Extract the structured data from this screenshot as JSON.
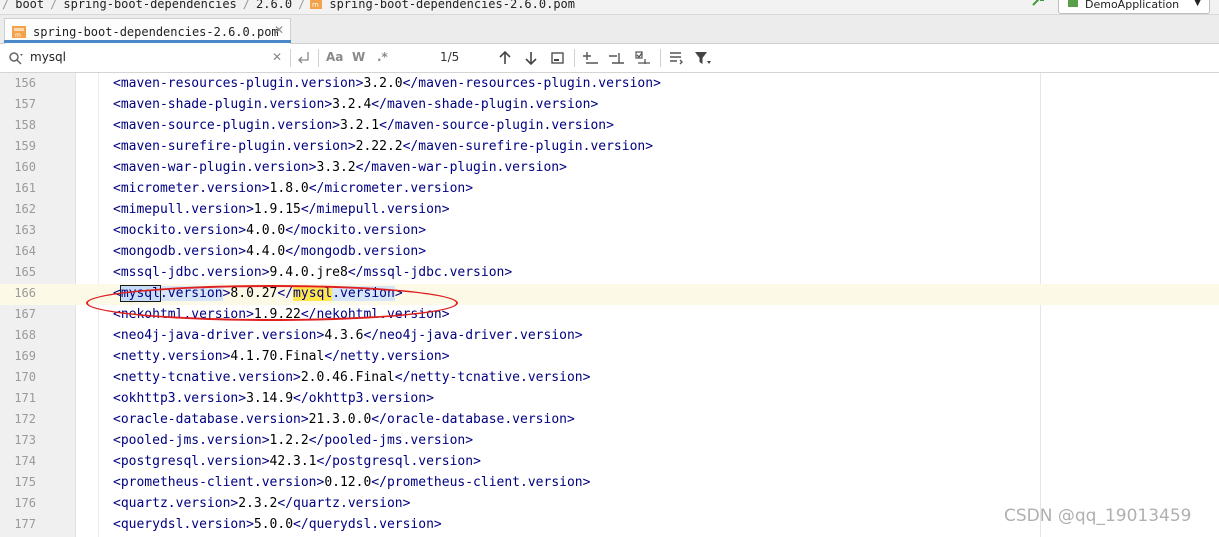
{
  "breadcrumb": [
    "boot",
    "spring-boot-dependencies",
    "2.6.0",
    "spring-boot-dependencies-2.6.0.pom"
  ],
  "run_config": "DemoApplication",
  "tab": {
    "label": "spring-boot-dependencies-2.6.0.pom"
  },
  "find": {
    "query": "mysql",
    "match_case": "Aa",
    "words": "W",
    "regex": ".*",
    "counter": "1/5"
  },
  "editor": {
    "lines": [
      {
        "n": "156",
        "tag": "maven-resources-plugin.version",
        "val": "3.2.0"
      },
      {
        "n": "157",
        "tag": "maven-shade-plugin.version",
        "val": "3.2.4"
      },
      {
        "n": "158",
        "tag": "maven-source-plugin.version",
        "val": "3.2.1"
      },
      {
        "n": "159",
        "tag": "maven-surefire-plugin.version",
        "val": "2.22.2"
      },
      {
        "n": "160",
        "tag": "maven-war-plugin.version",
        "val": "3.3.2"
      },
      {
        "n": "161",
        "tag": "micrometer.version",
        "val": "1.8.0"
      },
      {
        "n": "162",
        "tag": "mimepull.version",
        "val": "1.9.15"
      },
      {
        "n": "163",
        "tag": "mockito.version",
        "val": "4.0.0"
      },
      {
        "n": "164",
        "tag": "mongodb.version",
        "val": "4.4.0"
      },
      {
        "n": "165",
        "tag": "mssql-jdbc.version",
        "val": "9.4.0.jre8"
      },
      {
        "n": "166",
        "tag": "mysql.version",
        "val": "8.0.27",
        "match": true
      },
      {
        "n": "167",
        "tag": "nekohtml.version",
        "val": "1.9.22"
      },
      {
        "n": "168",
        "tag": "neo4j-java-driver.version",
        "val": "4.3.6"
      },
      {
        "n": "169",
        "tag": "netty.version",
        "val": "4.1.70.Final"
      },
      {
        "n": "170",
        "tag": "netty-tcnative.version",
        "val": "2.0.46.Final"
      },
      {
        "n": "171",
        "tag": "okhttp3.version",
        "val": "3.14.9"
      },
      {
        "n": "172",
        "tag": "oracle-database.version",
        "val": "21.3.0.0"
      },
      {
        "n": "173",
        "tag": "pooled-jms.version",
        "val": "1.2.2"
      },
      {
        "n": "174",
        "tag": "postgresql.version",
        "val": "42.3.1"
      },
      {
        "n": "175",
        "tag": "prometheus-client.version",
        "val": "0.12.0"
      },
      {
        "n": "176",
        "tag": "quartz.version",
        "val": "2.3.2"
      },
      {
        "n": "177",
        "tag": "querydsl.version",
        "val": "5.0.0"
      }
    ]
  },
  "watermark": "CSDN @qq_19013459"
}
